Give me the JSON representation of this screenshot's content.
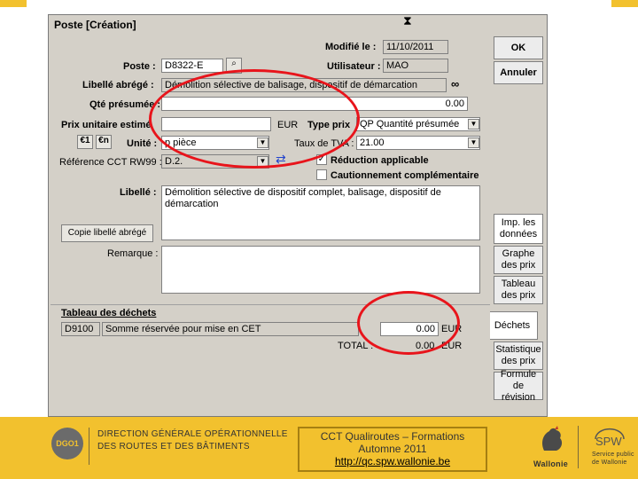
{
  "window": {
    "title": "Poste [Création]",
    "hourglass_icon": "hourglass-icon"
  },
  "header": {
    "modifie_label": "Modifié le :",
    "modifie_value": "11/10/2011",
    "utilisateur_label": "Utilisateur :",
    "utilisateur_value": "MAO"
  },
  "form": {
    "poste_label": "Poste :",
    "poste_value": "D8322-E",
    "libelle_abrege_label": "Libellé abrégé :",
    "libelle_abrege_value": "Démolition sélective de balisage, dispositif de démarcation",
    "qte_label": "Qté présumée :",
    "qte_value": "0.00",
    "prix_label": "Prix unitaire estimé",
    "prix_value": "",
    "prix_unit": "EUR",
    "type_prix_label": "Type prix",
    "type_prix_value": "QP Quantité présumée",
    "unite_label": "Unité :",
    "unite_value": "p pièce",
    "tva_label": "Taux de TVA :",
    "tva_value": "21.00",
    "reference_label": "Référence CCT RW99 :",
    "reference_value": "D.2.",
    "reduction_label": "Réduction applicable",
    "reduction_checked": "✓",
    "cautionnement_label": "Cautionnement complémentaire",
    "libelle_label": "Libellé :",
    "libelle_value": "Démolition sélective de dispositif complet, balisage, dispositif de démarcation",
    "copie_button": "Copie libellé abrégé",
    "remarque_label": "Remarque :",
    "euro_btn1": "€1",
    "euro_btn2": "€n"
  },
  "buttons": {
    "ok": "OK",
    "annuler": "Annuler",
    "imp_donnees": "Imp. les données",
    "graphe": "Graphe des prix",
    "tableau": "Tableau des prix",
    "dechets": "Déchets",
    "statistique": "Statistique des prix",
    "formule": "Formule de révision"
  },
  "dechets": {
    "title": "Tableau des déchets",
    "code": "D9100",
    "description": "Somme réservée pour mise en CET",
    "amount": "0.00",
    "unit": "EUR",
    "total_label": "TOTAL :",
    "total_value": "0.00",
    "total_unit": "EUR"
  },
  "footer": {
    "dgo_line1": "DIRECTION GÉNÉRALE OPÉRATIONNELLE",
    "dgo_line2": "DES ROUTES ET DES BÂTIMENTS",
    "logo_text": "DGO1",
    "box_line1": "CCT Qualiroutes – Formations",
    "box_line2": "Automne 2011",
    "box_url": "http://qc.spw.wallonie.be",
    "wallonie": "Wallonie",
    "spw": "SPW",
    "spw_sub1": "Service public",
    "spw_sub2": "de Wallonie"
  }
}
